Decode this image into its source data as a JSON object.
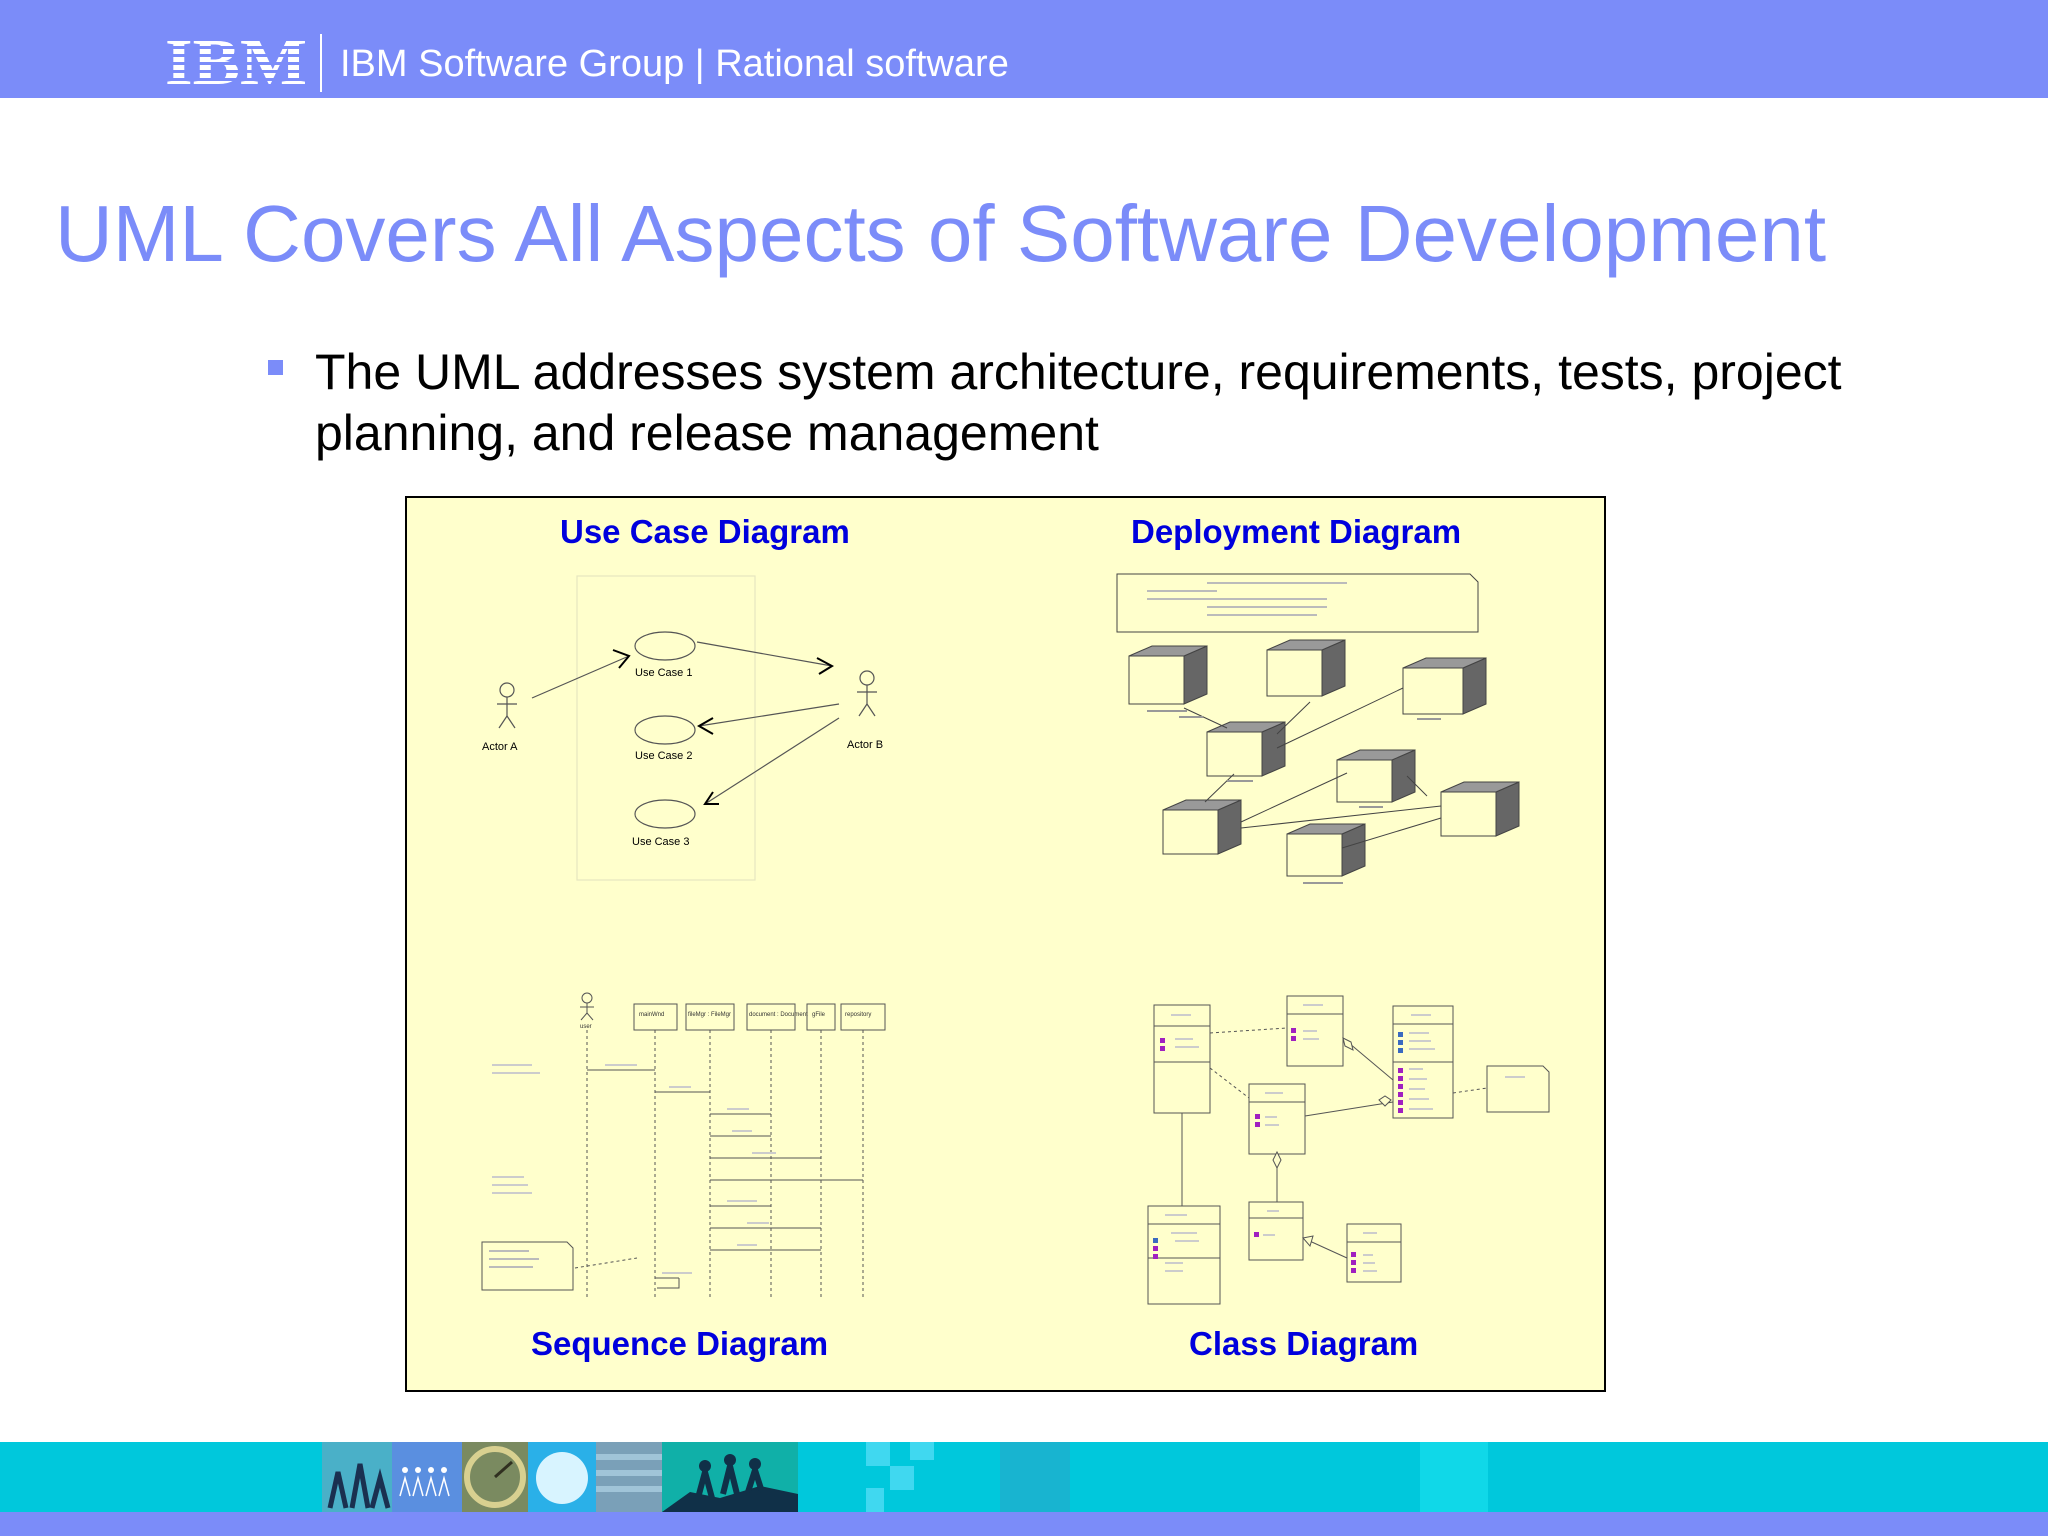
{
  "header": {
    "logo_text": "IBM",
    "title": "IBM Software Group | Rational software"
  },
  "slide": {
    "title": "UML Covers All Aspects of Software Development",
    "bullets": [
      "The UML addresses system architecture, requirements, tests, project planning, and release management"
    ]
  },
  "diagrams": {
    "use_case": {
      "label": "Use Case Diagram",
      "actors": [
        "Actor A",
        "Actor B"
      ],
      "use_cases": [
        "Use Case 1",
        "Use Case 2",
        "Use Case 3"
      ]
    },
    "deployment": {
      "label": "Deployment Diagram"
    },
    "sequence": {
      "label": "Sequence Diagram",
      "lifelines": [
        "user",
        "mainWnd",
        "fileMgr : FileMgr",
        "document : Document",
        "gFile",
        "repository"
      ]
    },
    "class": {
      "label": "Class Diagram"
    }
  },
  "colors": {
    "brand": "#7b8cf9",
    "diagram_background": "#ffffcc",
    "diagram_label": "#0000dd",
    "footer": "#00c8dc"
  }
}
